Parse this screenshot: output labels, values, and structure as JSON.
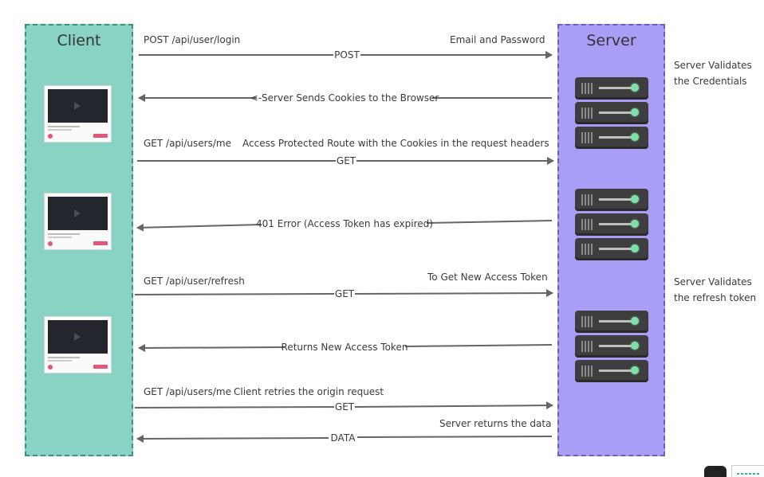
{
  "lanes": {
    "client": "Client",
    "server": "Server"
  },
  "labels": {
    "login_route": "POST /api/user/login",
    "login_body": "Email and Password",
    "me_route_1": "GET /api/users/me",
    "me_desc_1": "Access Protected Route with the Cookies in the request headers",
    "refresh_route": "GET /api/user/refresh",
    "refresh_desc": "To Get New Access Token",
    "me_route_2": "GET /api/users/me",
    "me_desc_2": "Client retries the origin request",
    "server_returns": "Server returns the data"
  },
  "arrows": {
    "a1": "POST",
    "a2": "<-Server Sends Cookies to the Browser",
    "a3": "GET",
    "a4": "401 Error (Access Token has expired)",
    "a5": "GET",
    "a6": "Returns New Access Token",
    "a7": "GET",
    "a8": "DATA"
  },
  "notes": {
    "validate_creds_1": "Server Validates",
    "validate_creds_2": "the Credentials",
    "validate_refresh_1": "Server Validates",
    "validate_refresh_2": "the refresh token"
  },
  "colors": {
    "client_lane": "#88d3c3",
    "server_lane": "#a99ef6",
    "arrow": "#666666",
    "server_led": "#7fe0a7"
  }
}
